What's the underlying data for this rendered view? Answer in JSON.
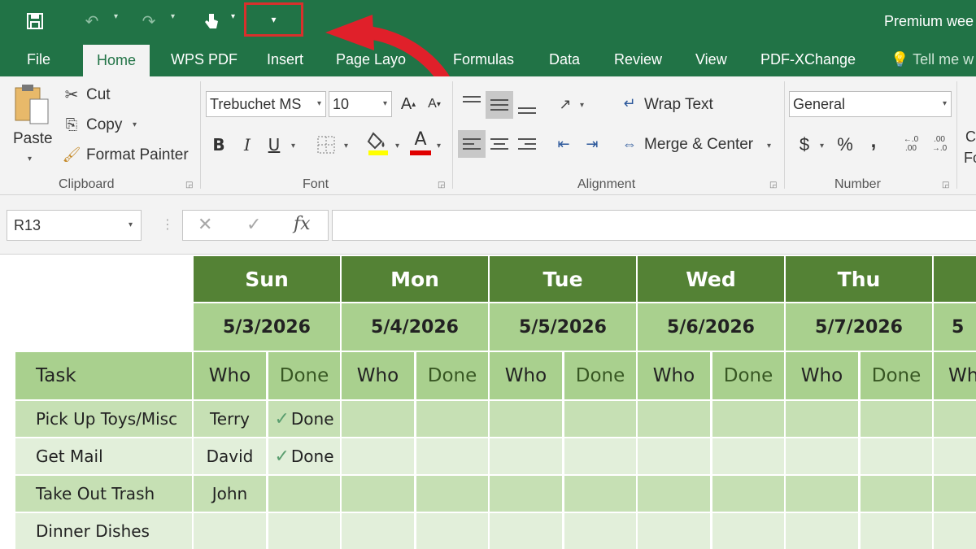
{
  "titlebar": {
    "title": "Premium wee",
    "qat_custom_glyph": "▾"
  },
  "tabs": [
    "File",
    "Home",
    "WPS PDF",
    "Insert",
    "Page Layo",
    "Formulas",
    "Data",
    "Review",
    "View",
    "PDF-XChange",
    "Tell me w"
  ],
  "ribbon": {
    "clipboard": {
      "paste": "Paste",
      "cut": "Cut",
      "copy": "Copy",
      "format_painter": "Format Painter",
      "label": "Clipboard"
    },
    "font": {
      "name": "Trebuchet MS",
      "size": "10",
      "bold": "B",
      "italic": "I",
      "underline": "U",
      "font_color_glyph": "A",
      "grow": "A",
      "shrink": "A",
      "label": "Font",
      "highlight_color": "#ffff00",
      "font_color": "#e00000"
    },
    "alignment": {
      "wrap_text": "Wrap Text",
      "merge_center": "Merge & Center",
      "label": "Alignment"
    },
    "number": {
      "format": "General",
      "currency": "$",
      "percent": "%",
      "comma": ",",
      "inc_decimal": "←.0\n.00",
      "dec_decimal": ".00\n→.0",
      "label": "Number"
    },
    "styles_partial": {
      "line1": "C",
      "line2": "Fo"
    }
  },
  "formula_bar": {
    "name_box": "R13",
    "cancel": "✕",
    "enter": "✓",
    "fx": "fx",
    "formula": ""
  },
  "sheet": {
    "days": [
      "Sun",
      "Mon",
      "Tue",
      "Wed",
      "Thu",
      ""
    ],
    "dates": [
      "5/3/2026",
      "5/4/2026",
      "5/5/2026",
      "5/6/2026",
      "5/7/2026",
      "5"
    ],
    "task_header": "Task",
    "who_header": "Who",
    "done_header": "Done",
    "partial_who_header": "Wh",
    "rows": [
      {
        "task": "Pick Up Toys/Misc",
        "who": "Terry",
        "done": "Done"
      },
      {
        "task": "Get Mail",
        "who": "David",
        "done": "Done"
      },
      {
        "task": "Take Out Trash",
        "who": "John",
        "done": ""
      },
      {
        "task": "Dinner Dishes",
        "who": "",
        "done": ""
      }
    ]
  },
  "colors": {
    "excel_green": "#217346",
    "day_header": "#548235",
    "date_header": "#a9d08e",
    "row_odd": "#c6e0b4",
    "row_even": "#e2efda",
    "highlight_box": "#d9302c",
    "arrow": "#e0202a"
  }
}
